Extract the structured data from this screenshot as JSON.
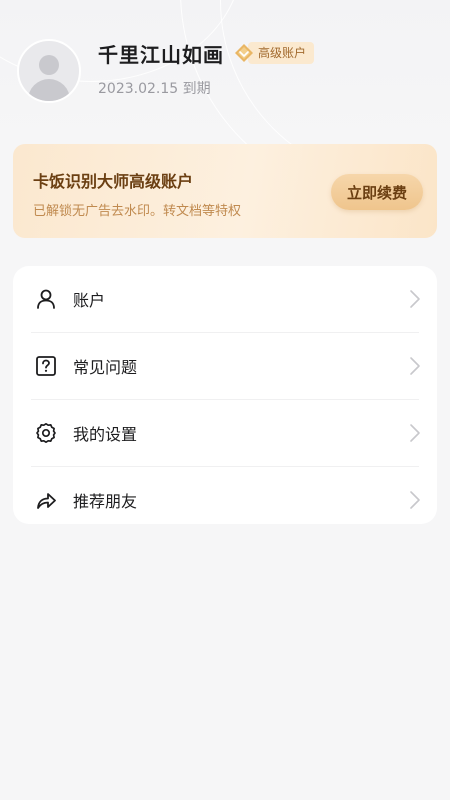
{
  "profile": {
    "username": "千里江山如画",
    "badge_label": "高级账户",
    "expiry": "2023.02.15 到期"
  },
  "vip_card": {
    "title": "卡饭识别大师高级账户",
    "description": "已解锁无广告去水印。转文档等特权",
    "renew_label": "立即续费"
  },
  "menu": {
    "items": [
      {
        "label": "账户",
        "icon": "user-icon"
      },
      {
        "label": "常见问题",
        "icon": "question-icon"
      },
      {
        "label": "我的设置",
        "icon": "gear-icon"
      },
      {
        "label": "推荐朋友",
        "icon": "share-icon"
      }
    ]
  },
  "colors": {
    "gold_dark": "#6b3f12",
    "gold_light": "#c08a4f",
    "badge_bg": "#fbe9cf",
    "diamond": "#e9b664"
  }
}
